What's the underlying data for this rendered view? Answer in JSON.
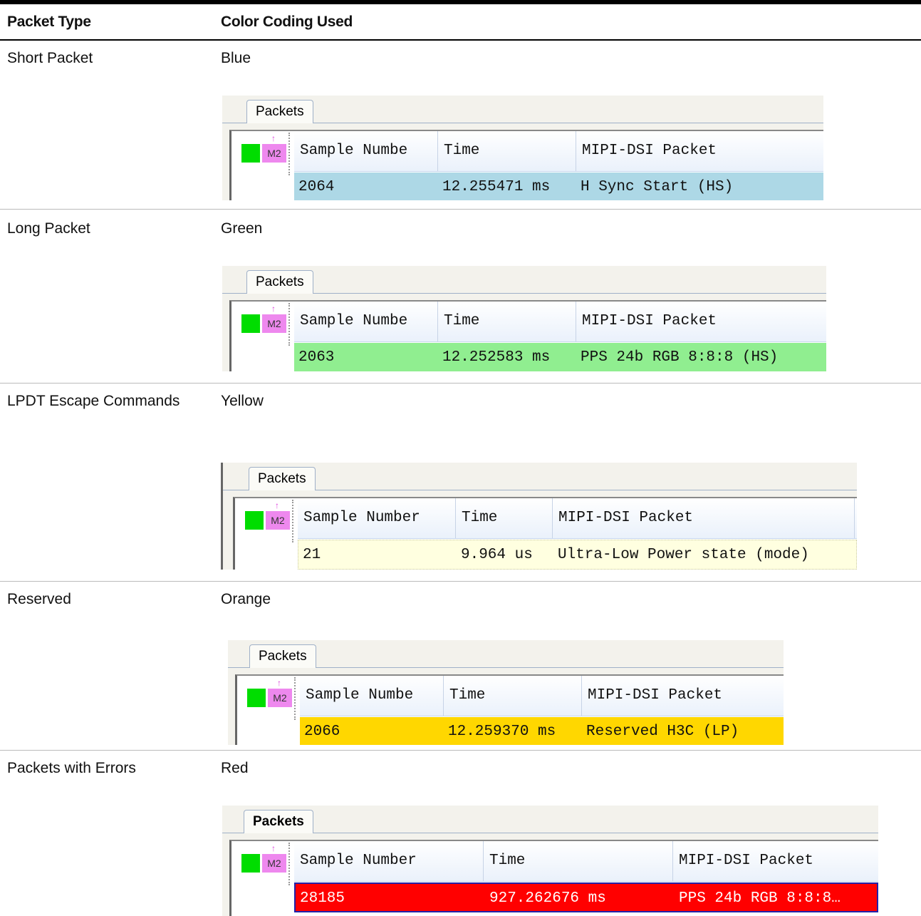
{
  "header": {
    "col1": "Packet Type",
    "col2": "Color Coding Used"
  },
  "rows": [
    {
      "type": "Short Packet",
      "color": "Blue",
      "bg": "#add8e6",
      "text_color": "#000000",
      "tab": "Packets",
      "marker": "M2",
      "columns": [
        "Sample Numbe",
        "Time",
        "MIPI-DSI Packet"
      ],
      "cells": [
        "2064",
        "12.255471 ms",
        "H Sync Start (HS)"
      ]
    },
    {
      "type": "Long Packet",
      "color": "Green",
      "bg": "#90ee90",
      "text_color": "#000000",
      "tab": "Packets",
      "marker": "M2",
      "columns": [
        "Sample Numbe",
        "Time",
        "MIPI-DSI Packet"
      ],
      "cells": [
        "2063",
        "12.252583 ms",
        "PPS 24b RGB 8:8:8 (HS)"
      ]
    },
    {
      "type": "LPDT Escape Commands",
      "color": "Yellow",
      "bg": "#ffffe0",
      "text_color": "#000000",
      "tab": "Packets",
      "marker": "M2",
      "columns": [
        "Sample Number",
        "Time",
        "MIPI-DSI Packet"
      ],
      "cells": [
        "21",
        "9.964 us",
        "Ultra-Low Power state (mode)"
      ]
    },
    {
      "type": "Reserved",
      "color": "Orange",
      "bg": "#ffd700",
      "text_color": "#000000",
      "tab": "Packets",
      "marker": "M2",
      "columns": [
        "Sample Numbe",
        "Time",
        "MIPI-DSI Packet"
      ],
      "cells": [
        "2066",
        "12.259370 ms",
        "Reserved H3C (LP)"
      ]
    },
    {
      "type": "Packets with Errors",
      "color": "Red",
      "bg": "#ff0000",
      "text_color": "#ffffff",
      "tab": "Packets",
      "marker": "M2",
      "columns": [
        "Sample Number",
        "Time",
        "MIPI-DSI Packet"
      ],
      "cells": [
        "28185",
        "927.262676 ms",
        "PPS 24b RGB 8:8:8…"
      ]
    }
  ]
}
